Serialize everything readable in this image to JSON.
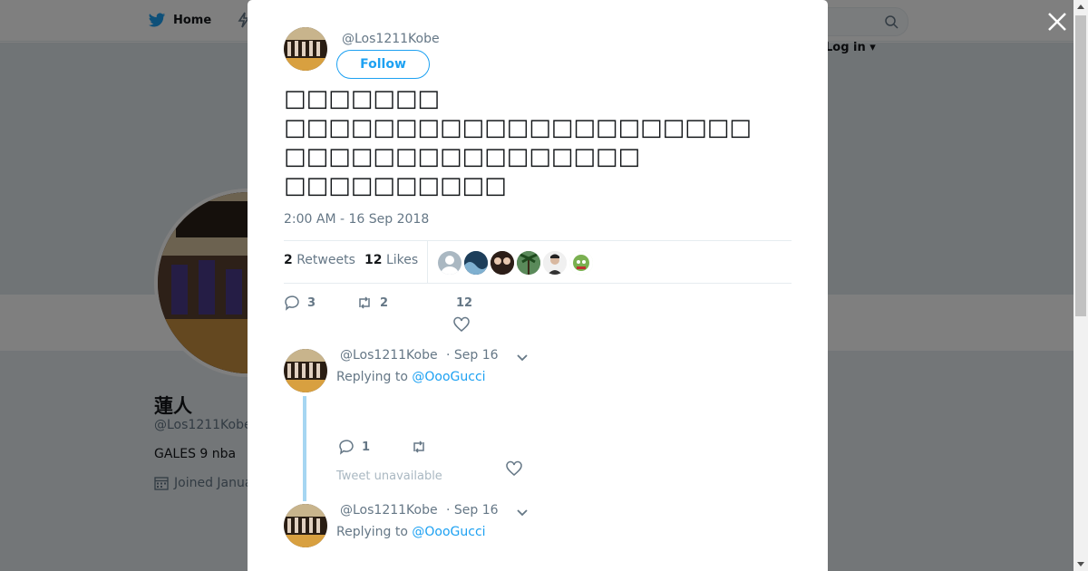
{
  "topbar": {
    "home_label": "Home",
    "login_label": "Log in"
  },
  "profile": {
    "name": "蓮人",
    "handle": "@Los1211Kobe",
    "bio": "GALES 9  nba",
    "joined": "Joined Janua"
  },
  "tweet": {
    "handle": "@Los1211Kobe",
    "follow_label": "Follow",
    "text": "□□□□□□□\n□□□□□□□□□□□□□□□□□□□□□\n□□□□□□□□□□□□□□□□\n□□□□□□□□□□",
    "timestamp": "2:00 AM - 16 Sep 2018",
    "retweets_count": "2",
    "retweets_label": "Retweets",
    "likes_count": "12",
    "likes_label": "Likes",
    "actions": {
      "reply_count": "3",
      "retweet_count": "2",
      "like_count": "12"
    }
  },
  "replies": [
    {
      "handle": "@Los1211Kobe",
      "date": "· Sep 16",
      "replying_prefix": "Replying to",
      "replying_to": "@OooGucci",
      "reply_count": "1",
      "unavailable": "Tweet unavailable"
    },
    {
      "handle": "@Los1211Kobe",
      "date": "· Sep 16",
      "replying_prefix": "Replying to",
      "replying_to": "@OooGucci"
    }
  ],
  "colors": {
    "accent": "#1da1f2",
    "muted": "#657786",
    "thread": "#a6d6f2"
  }
}
